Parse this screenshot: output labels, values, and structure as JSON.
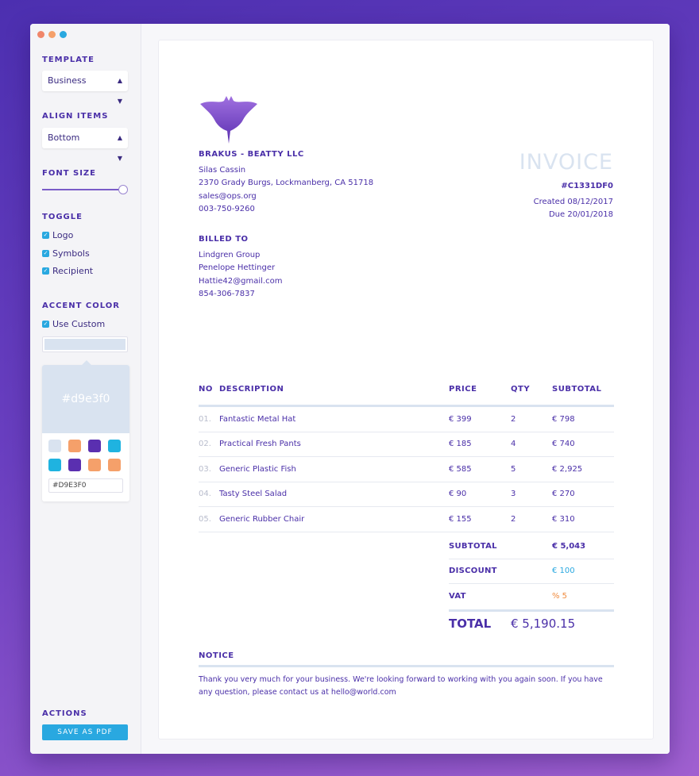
{
  "sidebar": {
    "template": {
      "title": "TEMPLATE",
      "value": "Business"
    },
    "align": {
      "title": "ALIGN ITEMS",
      "value": "Bottom"
    },
    "font_size": {
      "title": "FONT SIZE",
      "level": 1.0
    },
    "toggle": {
      "title": "TOGGLE",
      "items": [
        {
          "label": "Logo",
          "checked": true
        },
        {
          "label": "Symbols",
          "checked": true
        },
        {
          "label": "Recipient",
          "checked": true
        }
      ]
    },
    "accent": {
      "title": "ACCENT COLOR",
      "use_custom": "Use Custom",
      "current": "#d9e3f0",
      "hex_input": "#D9E3F0",
      "swatches": [
        "#d9e3f0",
        "#f5a06a",
        "#5a2fb0",
        "#1fb3e0",
        "#1fb3e0",
        "#5a2fb0",
        "#f5a06a",
        "#f5a06a"
      ]
    },
    "actions": {
      "title": "ACTIONS",
      "save_label": "SAVE AS PDF"
    }
  },
  "colors": {
    "primary": "#4a2fa8",
    "accent": "#d9e3f0",
    "button": "#29a8e0",
    "discount": "#29a8e0",
    "vat": "#f08a3c"
  },
  "invoice": {
    "company": {
      "name": "BRAKUS - BEATTY LLC",
      "contact": "Silas Cassin",
      "address": "2370 Grady Burgs, Lockmanberg, CA 51718",
      "email": "sales@ops.org",
      "phone": "003-750-9260"
    },
    "title": "INVOICE",
    "number": "#C1331DF0",
    "created": "Created 08/12/2017",
    "due": "Due 20/01/2018",
    "billed_to": {
      "title": "BILLED TO",
      "company": "Lindgren Group",
      "name": "Penelope Hettinger",
      "email": "Hattie42@gmail.com",
      "phone": "854-306-7837"
    },
    "columns": [
      "NO",
      "DESCRIPTION",
      "PRICE",
      "QTY",
      "SUBTOTAL"
    ],
    "items": [
      {
        "no": "01.",
        "desc": "Fantastic Metal Hat",
        "price": "€ 399",
        "qty": "2",
        "subtotal": "€ 798"
      },
      {
        "no": "02.",
        "desc": "Practical Fresh Pants",
        "price": "€ 185",
        "qty": "4",
        "subtotal": "€ 740"
      },
      {
        "no": "03.",
        "desc": "Generic Plastic Fish",
        "price": "€ 585",
        "qty": "5",
        "subtotal": "€ 2,925"
      },
      {
        "no": "04.",
        "desc": "Tasty Steel Salad",
        "price": "€ 90",
        "qty": "3",
        "subtotal": "€ 270"
      },
      {
        "no": "05.",
        "desc": "Generic Rubber Chair",
        "price": "€ 155",
        "qty": "2",
        "subtotal": "€ 310"
      }
    ],
    "totals": {
      "subtotal_label": "SUBTOTAL",
      "subtotal": "€ 5,043",
      "discount_label": "DISCOUNT",
      "discount": "€ 100",
      "vat_label": "VAT",
      "vat": "% 5",
      "total_label": "TOTAL",
      "total": "€ 5,190.15"
    },
    "notice": {
      "title": "NOTICE",
      "text": "Thank you very much for your business. We're looking forward to working with you again soon. If you have any question, please contact us at hello@world.com"
    }
  }
}
